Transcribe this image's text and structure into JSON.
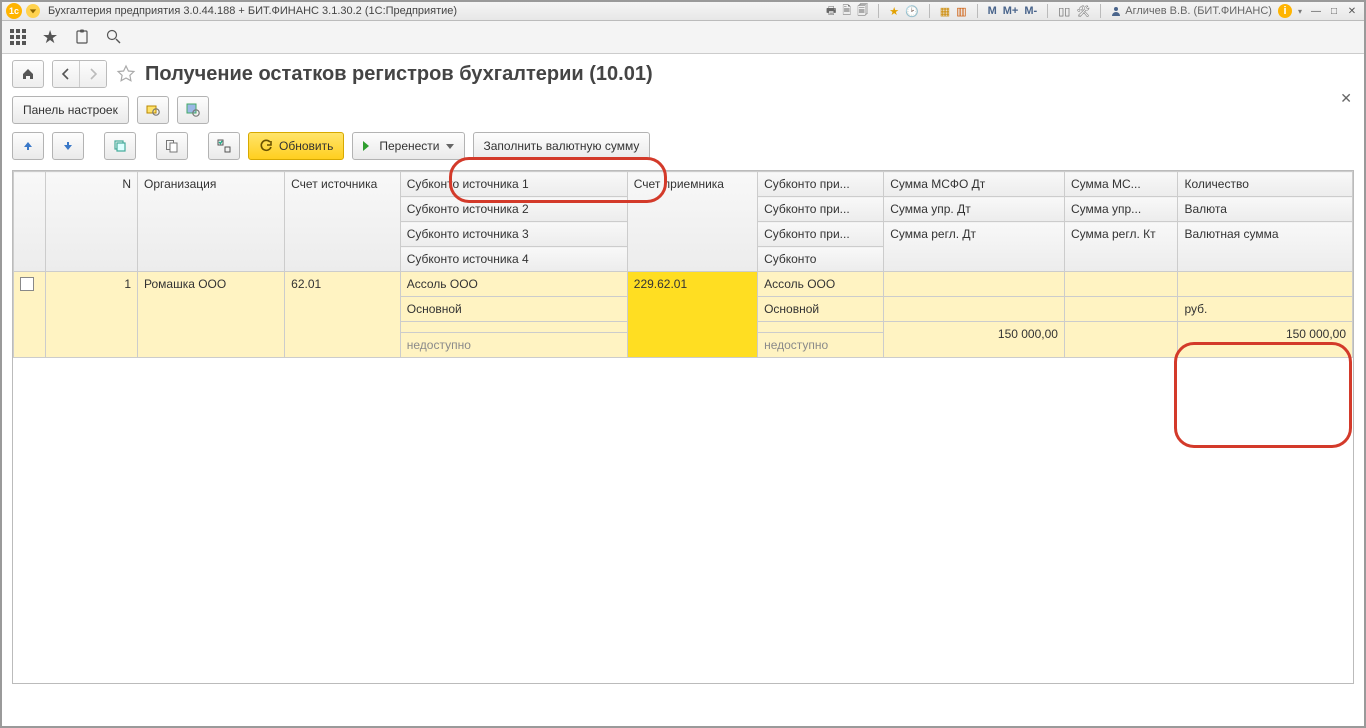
{
  "titlebar": {
    "app_title": "Бухгалтерия предприятия 3.0.44.188 + БИТ.ФИНАНС 3.1.30.2  (1С:Предприятие)",
    "user": "Агличев В.В. (БИТ.ФИНАНС)",
    "mbuttons": [
      "M",
      "M+",
      "M-"
    ]
  },
  "page": {
    "title": "Получение остатков регистров бухгалтерии (10.01)"
  },
  "toolbar": {
    "settings_panel": "Панель настроек",
    "refresh": "Обновить",
    "transfer": "Перенести",
    "fill_currency": "Заполнить валютную сумму"
  },
  "table": {
    "headers": {
      "n": "N",
      "org": "Организация",
      "acct_src": "Счет источника",
      "sub1": "Субконто источника 1",
      "sub2": "Субконто источника 2",
      "sub3": "Субконто источника 3",
      "sub4": "Субконто источника 4",
      "acct_dst": "Счет приемника",
      "subd1": "Субконто при...",
      "subd2": "Субконто при...",
      "subd3": "Субконто при...",
      "subd4": "Субконто",
      "sum_msfo_dt": "Сумма МСФО Дт",
      "sum_upr_dt": "Сумма упр. Дт",
      "sum_regl_dt": "Сумма регл. Дт",
      "sum_msfo_kt": "Сумма МС...",
      "sum_upr_kt": "Сумма упр...",
      "sum_regl_kt": "Сумма регл. Кт",
      "qty": "Количество",
      "currency": "Валюта",
      "cur_sum": "Валютная сумма"
    },
    "row": {
      "n": "1",
      "org": "Ромашка ООО",
      "acct_src": "62.01",
      "sub1": "Ассоль ООО",
      "sub2": "Основной",
      "sub3": "",
      "sub4": "недоступно",
      "acct_dst": "229.62.01",
      "subd1": "Ассоль ООО",
      "subd2": "Основной",
      "subd3": "",
      "subd4": "недоступно",
      "sum_regl_dt": "150 000,00",
      "currency": "руб.",
      "cur_sum": "150 000,00"
    }
  }
}
